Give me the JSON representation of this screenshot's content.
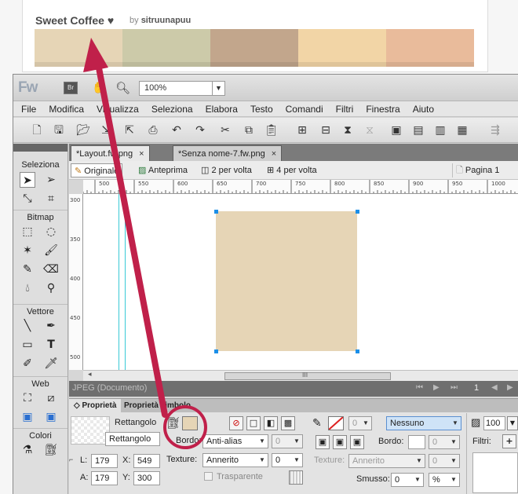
{
  "palette": {
    "title": "Sweet Coffee",
    "heart": "♥",
    "by_prefix": "by",
    "author": "sitruunapuu",
    "colors": [
      "#e6d5b6",
      "#cccaa9",
      "#c2a68c",
      "#f2d5a6",
      "#e9bb9b"
    ]
  },
  "app": {
    "logo": "Fw",
    "br_label": "Br",
    "zoom": "100%",
    "menu": [
      "File",
      "Modifica",
      "Visualizza",
      "Seleziona",
      "Elabora",
      "Testo",
      "Comandi",
      "Filtri",
      "Finestra",
      "Aiuto"
    ],
    "doc_tabs": [
      {
        "label": "*Layout.fw.png",
        "close": "×"
      },
      {
        "label": "*Senza nome-7.fw.png",
        "close": "×"
      }
    ],
    "view_buttons": [
      "Originale",
      "Anteprima",
      "2 per volta",
      "4 per volta"
    ],
    "page_label": "Pagina 1",
    "ruler_top": [
      "500",
      "550",
      "600",
      "650",
      "700",
      "750",
      "800",
      "850",
      "900",
      "950",
      "1000"
    ],
    "ruler_left": [
      "300",
      "350",
      "400",
      "450",
      "500"
    ],
    "rect_color": "#e6d5b6",
    "status": "JPEG (Documento)",
    "page_number": "1",
    "scroll_grip": "III"
  },
  "tools_panel": {
    "sections": [
      "Seleziona",
      "Bitmap",
      "Vettore",
      "Web",
      "Colori"
    ]
  },
  "properties": {
    "tabs": [
      "Proprietà",
      "Proprietà simbolo"
    ],
    "shape_type": "Rettangolo",
    "shape_name": "Rettangolo",
    "fill_color": "#e6d5b6",
    "border_label": "Bordo:",
    "border_value": "Anti-alias",
    "border_num": "0",
    "texture_label": "Texture:",
    "texture_value": "Annerito",
    "texture_num": "0",
    "transparent_label": "Trasparente",
    "w_label": "L:",
    "w_value": "179",
    "h_label": "A:",
    "h_value": "179",
    "x_label": "X:",
    "x_value": "549",
    "y_label": "Y:",
    "y_value": "300",
    "stroke_num": "0",
    "stroke_style": "Nessuno",
    "stroke_border_label": "Bordo:",
    "stroke_texture_label": "Texture:",
    "stroke_texture_value": "Annerito",
    "stroke_texture_num": "0",
    "smooth_label": "Smusso:",
    "smooth_value": "0",
    "smooth_unit": "%",
    "stroke_size_num": "0",
    "opacity": "100",
    "filters_label": "Filtri:",
    "filters_add": "+"
  },
  "annotation": {
    "arrow_color": "#c0204a",
    "circle_color": "#c0204a"
  }
}
